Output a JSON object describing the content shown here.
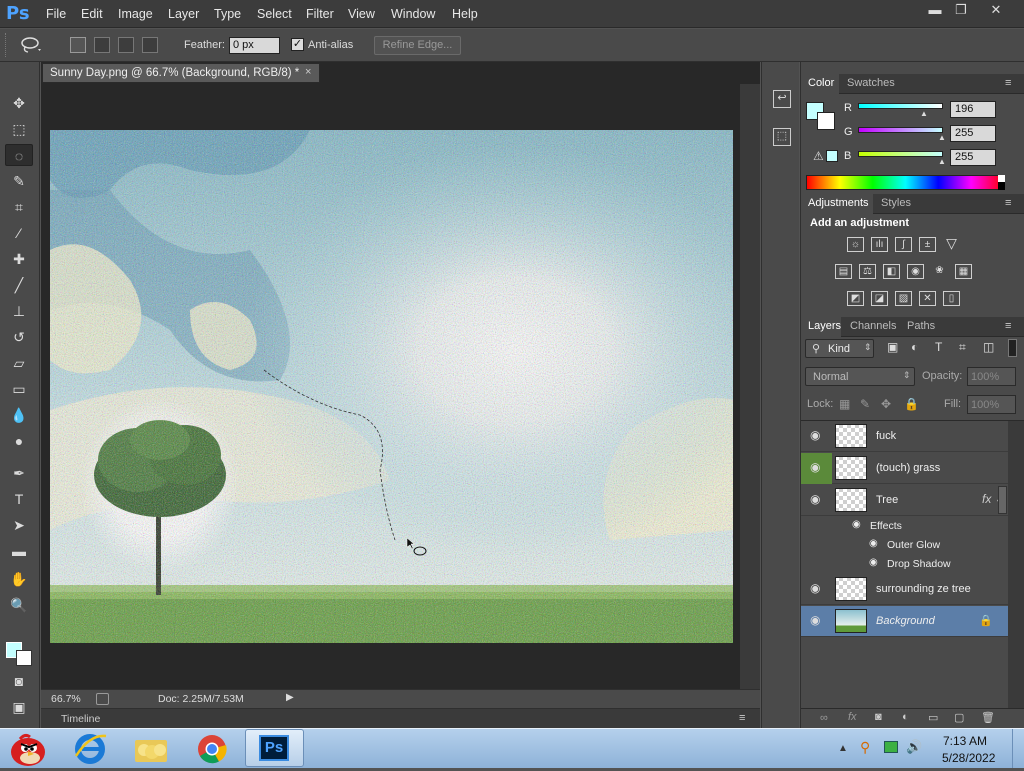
{
  "app": {
    "logo": "Ps",
    "menu": [
      "File",
      "Edit",
      "Image",
      "Layer",
      "Type",
      "Select",
      "Filter",
      "View",
      "Window",
      "Help"
    ],
    "window_controls": {
      "minimize": "▬",
      "restore": "❐",
      "close": "✕"
    }
  },
  "options": {
    "feather_label": "Feather:",
    "feather_value": "0 px",
    "antialias_label": "Anti-alias",
    "antialias_check": "✓",
    "refine_label": "Refine Edge..."
  },
  "document": {
    "tab_title": "Sunny Day.png @ 66.7% (Background, RGB/8) *",
    "tab_close": "×",
    "zoom": "66.7%",
    "doc_info": "Doc: 2.25M/7.53M",
    "timeline_label": "Timeline"
  },
  "color_panel": {
    "tabs": [
      "Color",
      "Swatches"
    ],
    "foreground": "#c4ffff",
    "channels": [
      {
        "label": "R",
        "value": "196"
      },
      {
        "label": "G",
        "value": "255"
      },
      {
        "label": "B",
        "value": "255"
      }
    ]
  },
  "adjustments_panel": {
    "tabs": [
      "Adjustments",
      "Styles"
    ],
    "heading": "Add an adjustment",
    "icons_row1": [
      "brightness-icon",
      "levels-icon",
      "curves-icon",
      "exposure-icon",
      "vibrance-icon"
    ],
    "icons_row2": [
      "hue-saturation-icon",
      "color-balance-icon",
      "black-white-icon",
      "photo-filter-icon",
      "channel-mixer-icon",
      "color-lookup-icon"
    ],
    "icons_row3": [
      "invert-icon",
      "posterize-icon",
      "threshold-icon",
      "selective-color-icon",
      "gradient-map-icon"
    ]
  },
  "layers_panel": {
    "tabs": [
      "Layers",
      "Channels",
      "Paths"
    ],
    "kind_label": "Kind",
    "blend_mode": "Normal",
    "opacity_label": "Opacity:",
    "opacity_value": "100%",
    "lock_label": "Lock:",
    "fill_label": "Fill:",
    "fill_value": "100%",
    "fx_label": "fx",
    "layers": [
      {
        "name": "fuck"
      },
      {
        "name": "(touch) grass"
      },
      {
        "name": "Tree"
      },
      {
        "name": "surrounding ze tree"
      },
      {
        "name": "Background"
      }
    ],
    "effects_label": "Effects",
    "effects": [
      "Outer Glow",
      "Drop Shadow"
    ]
  },
  "taskbar": {
    "time": "7:13 AM",
    "date": "5/28/2022",
    "ps_label": "Ps"
  }
}
